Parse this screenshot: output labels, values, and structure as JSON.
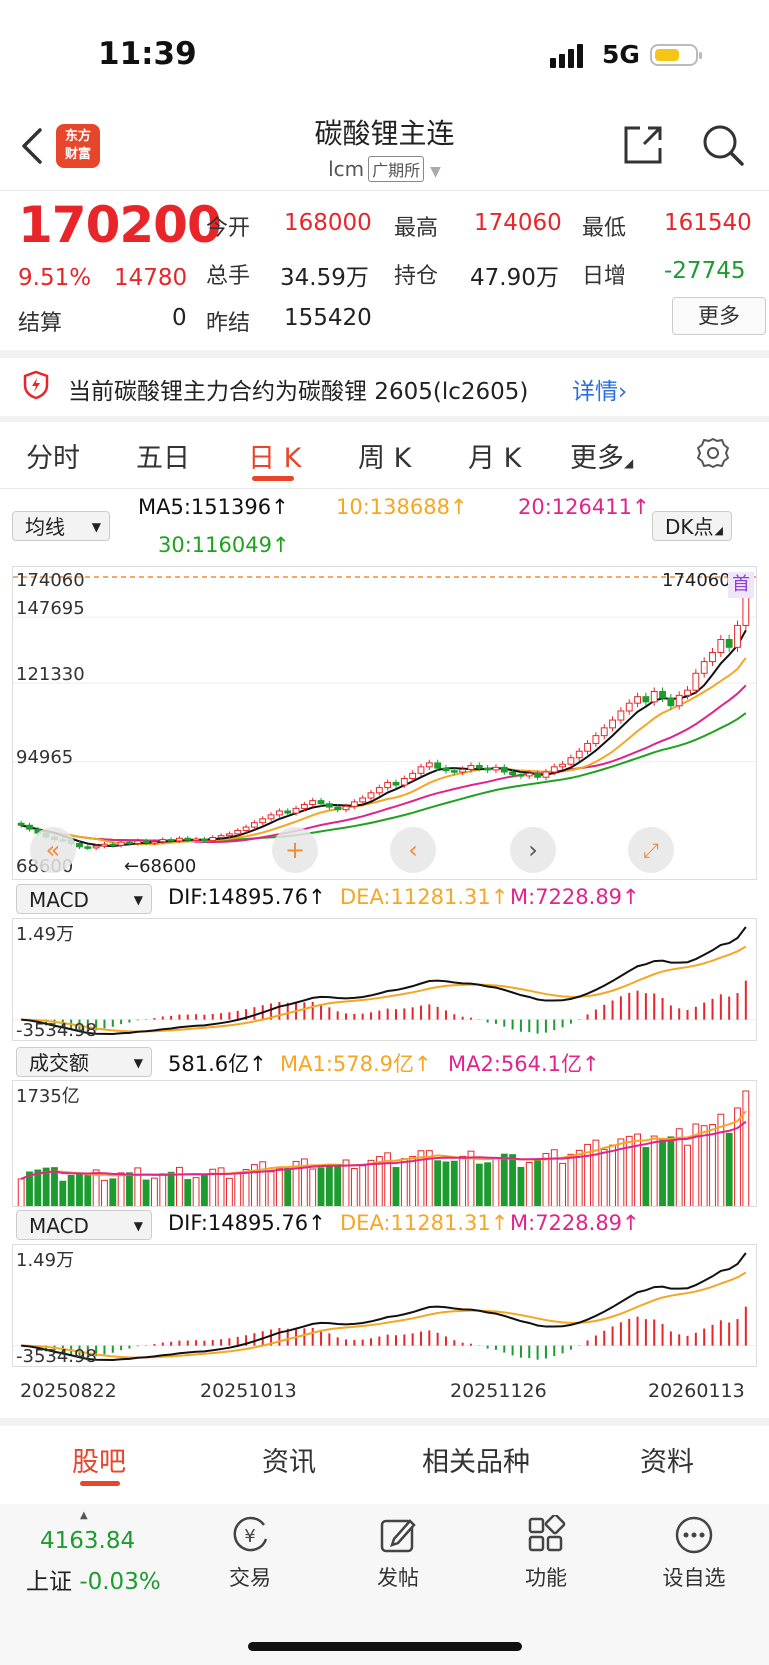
{
  "status": {
    "time": "11:39",
    "network": "5G"
  },
  "nav": {
    "logo_line1": "东方",
    "logo_line2": "财富",
    "title": "碳酸锂主连",
    "code": "lcm",
    "exchange": "广期所"
  },
  "quote": {
    "price": "170200",
    "change_pct": "9.51%",
    "change": "14780",
    "open_label": "今开",
    "open": "168000",
    "high_label": "最高",
    "high": "174060",
    "low_label": "最低",
    "low": "161540",
    "volume_label": "总手",
    "volume": "34.59万",
    "oi_label": "持仓",
    "oi": "47.90万",
    "daily_inc_label": "日增",
    "daily_inc": "-27745",
    "settle_label": "结算",
    "settle": "0",
    "prev_settle_label": "昨结",
    "prev_settle": "155420",
    "more_label": "更多"
  },
  "notice": {
    "text": "当前碳酸锂主力合约为碳酸锂 2605(lc2605)",
    "link": "详情"
  },
  "tabs": [
    "分时",
    "五日",
    "日 K",
    "周 K",
    "月 K",
    "更多"
  ],
  "active_tab": "日 K",
  "indicators": {
    "ma_selector": "均线",
    "ma5": "MA5:151396",
    "ma10": "10:138688",
    "ma20": "20:126411",
    "ma30": "30:116049",
    "dk_label": "DK点",
    "macd_selector": "MACD",
    "dif": "DIF:14895.76",
    "dea": "DEA:11281.31",
    "m": "M:7228.89",
    "vol_selector": "成交额",
    "vol_value": "581.6亿",
    "vol_ma1": "MA1:578.9亿",
    "vol_ma2": "MA2:564.1亿"
  },
  "axes": {
    "price_ticks": [
      "174060",
      "147695",
      "121330",
      "94965",
      "68600"
    ],
    "right_high": "174060",
    "low_marker": "68600",
    "macd_top": "1.49万",
    "macd_bottom": "-3534.98",
    "vol_top": "1735亿",
    "dates": [
      "20250822",
      "20251013",
      "20251126",
      "20260113"
    ]
  },
  "colors": {
    "up": "#e8262a",
    "down": "#1c9b2f",
    "ma5": "#111111",
    "ma10": "#f5a623",
    "ma20": "#e0248a",
    "ma30": "#1ea21e",
    "accent": "#e8462a",
    "link": "#2a6fdb"
  },
  "bottom_tabs": [
    "股吧",
    "资讯",
    "相关品种",
    "资料"
  ],
  "dock": {
    "index_value": "4163.84",
    "index_name": "上证",
    "index_change": "-0.03%",
    "items": [
      "交易",
      "发帖",
      "功能",
      "设自选"
    ]
  },
  "chart_data": {
    "type": "candlestick",
    "title": "",
    "ylim": [
      68600,
      174060
    ],
    "closes": [
      78500,
      77000,
      75500,
      74000,
      73000,
      72800,
      71500,
      70200,
      69800,
      70500,
      71200,
      70800,
      72000,
      71500,
      72500,
      71800,
      72200,
      73000,
      72500,
      73500,
      72800,
      73200,
      72600,
      73800,
      74500,
      75200,
      76500,
      77800,
      79500,
      81000,
      82500,
      84000,
      83200,
      85000,
      86500,
      88000,
      86800,
      85500,
      84500,
      85800,
      87500,
      89000,
      91000,
      93000,
      95000,
      94000,
      96500,
      98500,
      101000,
      102500,
      100500,
      99500,
      99000,
      100000,
      101500,
      100500,
      99800,
      100800,
      99000,
      98000,
      97500,
      98500,
      97000,
      99000,
      101000,
      102000,
      104500,
      107000,
      110000,
      113000,
      116000,
      119000,
      122500,
      125500,
      128000,
      126000,
      130000,
      127500,
      124500,
      128500,
      130500,
      137000,
      141500,
      145000,
      150000,
      147000,
      155420,
      170200
    ],
    "ma5_last": 151396,
    "ma10_last": 138688,
    "ma20_last": 126411,
    "ma30_last": 116049,
    "volume_ylim": [
      0,
      1735
    ]
  }
}
